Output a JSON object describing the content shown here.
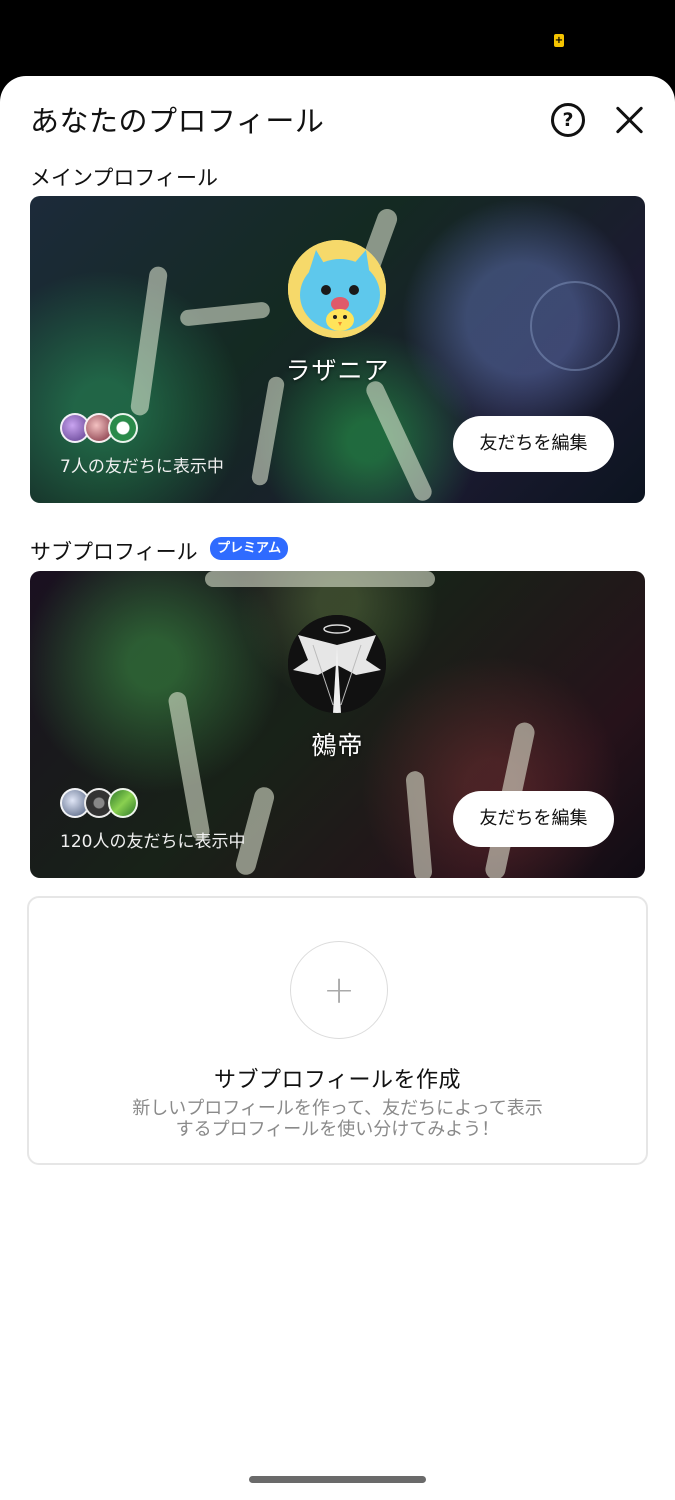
{
  "status_bar": {
    "battery_icon": "battery-saver-icon"
  },
  "header": {
    "title": "あなたのプロフィール",
    "help_label": "?",
    "help_icon": "help-icon",
    "close_icon": "close-icon"
  },
  "main_profile": {
    "section_label": "メインプロフィール",
    "name": "ラザニア",
    "friends_text": "7人の友だちに表示中",
    "edit_button": "友だちを編集"
  },
  "sub_profile": {
    "section_label": "サブプロフィール",
    "badge": "プレミアム",
    "name": "鵺帝",
    "friends_text": "120人の友だちに表示中",
    "edit_button": "友だちを編集"
  },
  "create_sub_profile": {
    "plus_label": "+",
    "title": "サブプロフィールを作成",
    "description_line1": "新しいプロフィールを作って、友だちによって表示",
    "description_line2": "するプロフィールを使い分けてみよう！"
  },
  "colors": {
    "premium_badge": "#2f6bff",
    "sheet_background": "#ffffff",
    "status_bar": "#000000"
  }
}
